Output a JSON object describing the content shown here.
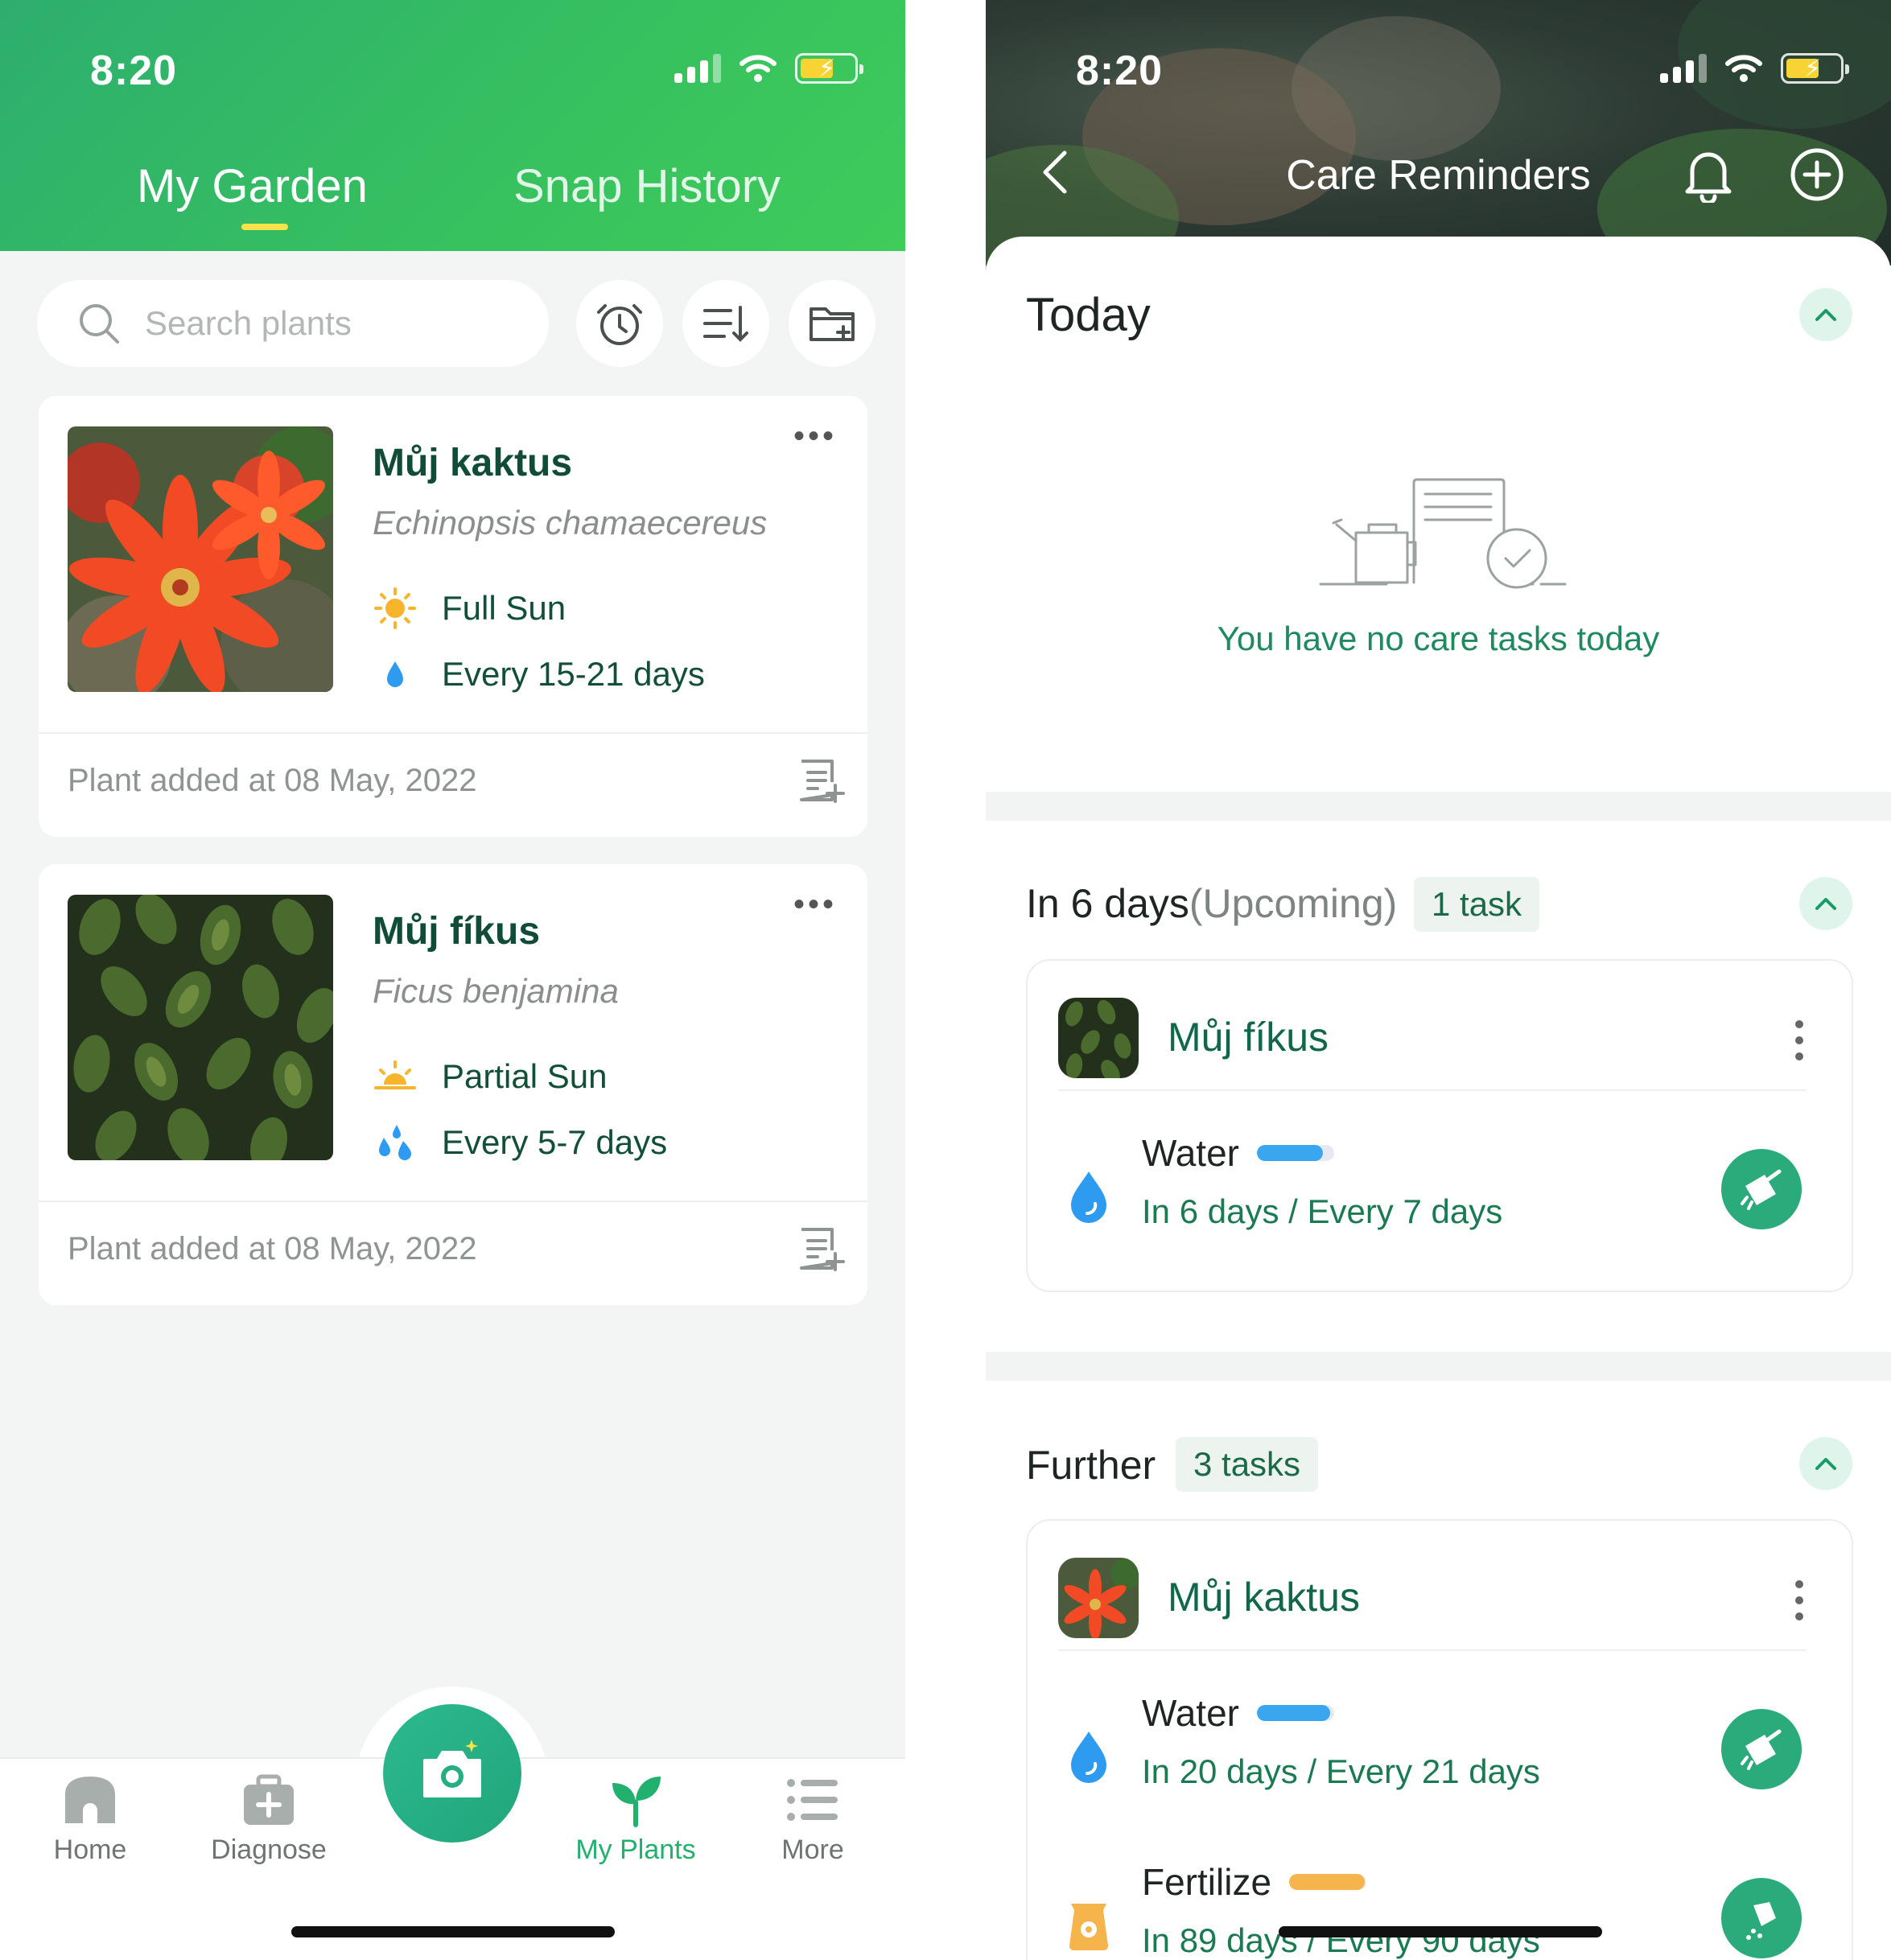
{
  "left": {
    "status_time": "8:20",
    "tabs": [
      {
        "label": "My Garden",
        "active": true
      },
      {
        "label": "Snap History",
        "active": false
      }
    ],
    "search": {
      "placeholder": "Search plants"
    },
    "plants": [
      {
        "name": "Můj kaktus",
        "latin": "Echinopsis chamaecereus",
        "light": "Full Sun",
        "water": "Every 15-21 days",
        "added": "Plant added at 08 May, 2022"
      },
      {
        "name": "Můj fíkus",
        "latin": "Ficus benjamina",
        "light": "Partial Sun",
        "water": "Every 5-7 days",
        "added": "Plant added at 08 May, 2022"
      }
    ],
    "nav": [
      {
        "label": "Home",
        "icon": "home-icon"
      },
      {
        "label": "Diagnose",
        "icon": "diagnose-icon"
      },
      {
        "label": "My Plants",
        "icon": "sprout-icon",
        "active": true
      },
      {
        "label": "More",
        "icon": "list-icon"
      }
    ]
  },
  "right": {
    "status_time": "8:20",
    "title": "Care Reminders",
    "today": {
      "title": "Today",
      "empty_text": "You have no care tasks today"
    },
    "upcoming": {
      "title": "In 6 days",
      "suffix": "(Upcoming)",
      "count": "1 task",
      "card": {
        "plant": "Můj fíkus",
        "tasks": [
          {
            "label": "Water",
            "schedule": "In 6 days / Every 7 days",
            "progress": 0.85,
            "color": "#3aa6f0"
          }
        ]
      }
    },
    "further": {
      "title": "Further",
      "count": "3 tasks",
      "card": {
        "plant": "Můj kaktus",
        "tasks": [
          {
            "label": "Water",
            "schedule": "In 20 days / Every 21 days",
            "progress": 0.95,
            "color": "#3aa6f0"
          },
          {
            "label": "Fertilize",
            "schedule": "In 89 days / Every 90 days",
            "progress": 0.98,
            "color": "#f6b44c"
          }
        ]
      }
    }
  }
}
